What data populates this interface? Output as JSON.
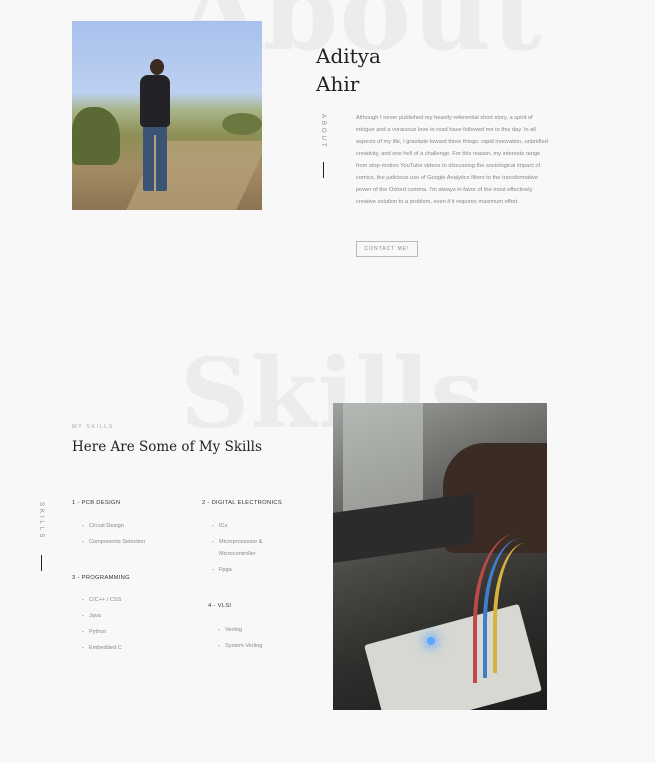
{
  "about": {
    "background_word": "About",
    "name_first": "Aditya",
    "name_last": "Ahir",
    "vertical_label": "ABOUT",
    "text": "Although I never published my heavily referential short story, a spirit of intrigue and a voracious love to read have followed me to this day. In all aspects of my life, I gravitate toward three things: rapid innovation, unbridled creativity, and one hell of a challenge. For this reason, my interests range from stop-motion YouTube videos to discussing the sociological impact of comics, the judicious use of Google Analytics filters to the transformative power of the Oxford comma. I'm always in favor of the most effectively creative solution to a problem, even if it requires maximum effort.",
    "contact_button": "CONTACT ME!"
  },
  "skills": {
    "background_word": "Skills",
    "eyebrow": "MY SKILLS",
    "heading": "Here Are Some of My Skills",
    "vertical_label": "SKILLS",
    "categories": [
      {
        "title": "1 - PCB DESIGN",
        "items": [
          "Circuit Design",
          "Components Selection"
        ]
      },
      {
        "title": "2 - DIGITAL ELECTRONICS",
        "items": [
          "ICs",
          "Microprocessor & Microcontroller",
          "Fpga"
        ]
      },
      {
        "title": "3 - PROGRAMMING",
        "items": [
          "C/C++ / CSS",
          "Java",
          "Python",
          "Embedded C"
        ]
      },
      {
        "title": "4 - VLSI",
        "items": [
          "Verilog",
          "System Verilog"
        ]
      }
    ]
  }
}
